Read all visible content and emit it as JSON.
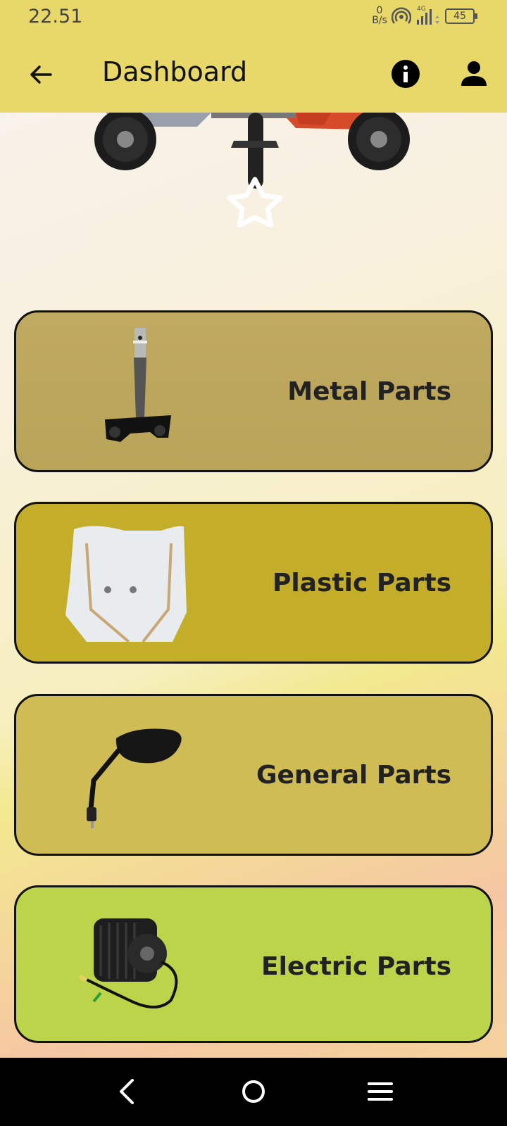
{
  "status_bar": {
    "time": "22.51",
    "net_speed_value": "0",
    "net_speed_unit": "B/s",
    "network_type": "4G",
    "battery": "45"
  },
  "app_bar": {
    "title": "Dashboard",
    "back_icon": "arrow-back-icon",
    "info_icon": "info-icon",
    "profile_icon": "person-icon"
  },
  "banner": {
    "image": "electric-scooter-image",
    "overlay_icon": "star-outline-icon"
  },
  "categories": [
    {
      "label": "Metal Parts",
      "image": "steering-stem-image",
      "color": "#bca85c"
    },
    {
      "label": "Plastic Parts",
      "image": "headlight-cover-image",
      "color": "#c4ad28"
    },
    {
      "label": "General Parts",
      "image": "side-mirror-image",
      "color": "#d0bc54"
    },
    {
      "label": "Electric Parts",
      "image": "electric-motor-image",
      "color": "#bcd44a"
    }
  ],
  "nav_bar": {
    "back_icon": "nav-back-icon",
    "home_icon": "nav-home-icon",
    "menu_icon": "nav-menu-icon"
  }
}
